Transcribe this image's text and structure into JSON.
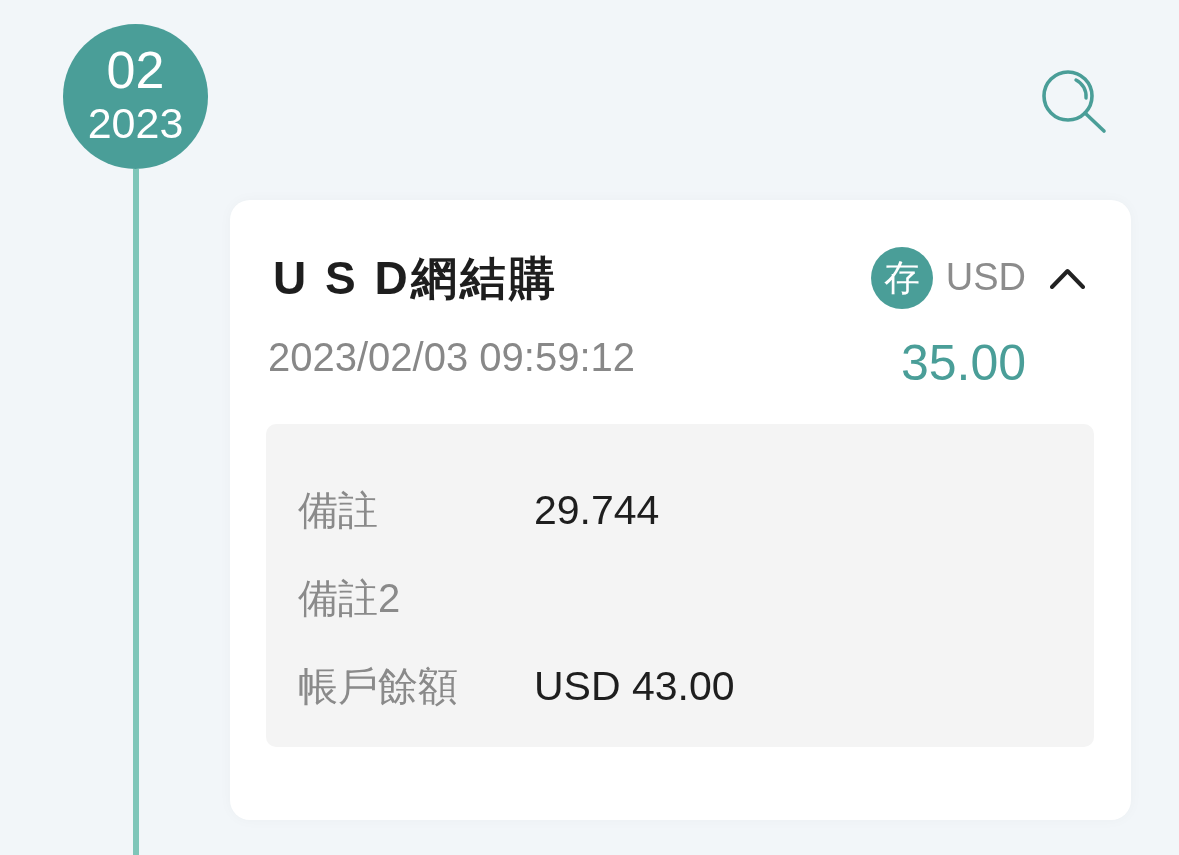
{
  "timeline_marker": {
    "month": "02",
    "year": "2023"
  },
  "transaction": {
    "title": "U S D網結購",
    "badge": "存",
    "currency": "USD",
    "expanded": true,
    "datetime": "2023/02/03 09:59:12",
    "amount": "35.00",
    "details": [
      {
        "label": "備註",
        "value": "29.744"
      },
      {
        "label": "備註2"
      },
      {
        "label": "帳戶餘額",
        "value": "USD 43.00"
      }
    ]
  }
}
